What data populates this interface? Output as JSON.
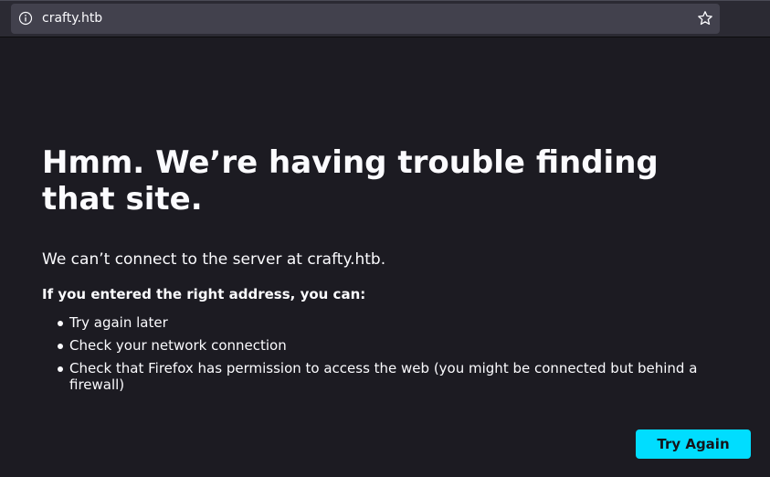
{
  "toolbar": {
    "url": "crafty.htb",
    "left_icon": "info-icon",
    "right_icon": "star-icon"
  },
  "error": {
    "title": "Hmm. We’re having trouble finding that site.",
    "lead": "We can’t connect to the server at crafty.htb.",
    "subhead": "If you entered the right address, you can:",
    "suggestions": [
      "Try again later",
      "Check your network connection",
      "Check that Firefox has permission to access the web (you might be connected but behind a firewall)"
    ],
    "try_again_label": "Try Again"
  },
  "colors": {
    "page_background": "#1c1b22",
    "toolbar_background": "#2b2a33",
    "urlbar_background": "#42414d",
    "text": "#fbfbfe",
    "primary_button": "#00ddff",
    "primary_button_text": "#15141a"
  }
}
